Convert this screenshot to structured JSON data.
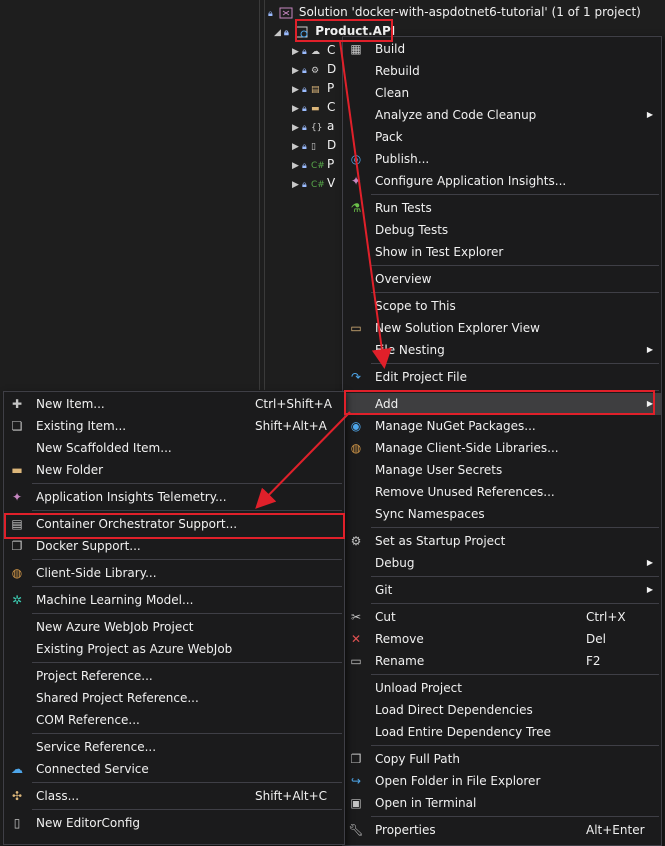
{
  "explorer": {
    "solution": "Solution 'docker-with-aspdotnet6-tutorial'   (1 of 1 project)",
    "project": "Product.API",
    "children": [
      "C",
      "D",
      "P",
      "C",
      "a",
      "D",
      "P",
      "V"
    ]
  },
  "context_menu": {
    "items": [
      {
        "label": "Build",
        "icon": "build-icon"
      },
      {
        "label": "Rebuild"
      },
      {
        "label": "Clean"
      },
      {
        "label": "Analyze and Code Cleanup",
        "submenu": true
      },
      {
        "label": "Pack"
      },
      {
        "label": "Publish...",
        "icon": "publish-globe-icon"
      },
      {
        "label": "Configure Application Insights...",
        "icon": "app-insights-icon"
      },
      {
        "sep": true
      },
      {
        "label": "Run Tests",
        "icon": "run-tests-icon"
      },
      {
        "label": "Debug Tests"
      },
      {
        "label": "Show in Test Explorer"
      },
      {
        "sep": true
      },
      {
        "label": "Overview"
      },
      {
        "sep": true
      },
      {
        "label": "Scope to This"
      },
      {
        "label": "New Solution Explorer View",
        "icon": "new-view-icon"
      },
      {
        "label": "File Nesting",
        "submenu": true
      },
      {
        "sep": true
      },
      {
        "label": "Edit Project File",
        "icon": "edit-arrow-icon"
      },
      {
        "sep": true
      },
      {
        "label": "Add",
        "submenu": true,
        "highlight": true
      },
      {
        "label": "Manage NuGet Packages...",
        "icon": "nuget-icon"
      },
      {
        "label": "Manage Client-Side Libraries...",
        "icon": "client-lib-icon"
      },
      {
        "label": "Manage User Secrets"
      },
      {
        "label": "Remove Unused References..."
      },
      {
        "label": "Sync Namespaces"
      },
      {
        "sep": true
      },
      {
        "label": "Set as Startup Project",
        "icon": "gear-icon"
      },
      {
        "label": "Debug",
        "submenu": true
      },
      {
        "sep": true
      },
      {
        "label": "Git",
        "submenu": true
      },
      {
        "sep": true
      },
      {
        "label": "Cut",
        "icon": "scissors-icon",
        "shortcut": "Ctrl+X"
      },
      {
        "label": "Remove",
        "icon": "remove-x-icon",
        "shortcut": "Del"
      },
      {
        "label": "Rename",
        "icon": "rename-icon",
        "shortcut": "F2"
      },
      {
        "sep": true
      },
      {
        "label": "Unload Project"
      },
      {
        "label": "Load Direct Dependencies"
      },
      {
        "label": "Load Entire Dependency Tree"
      },
      {
        "sep": true
      },
      {
        "label": "Copy Full Path",
        "icon": "copy-icon"
      },
      {
        "label": "Open Folder in File Explorer",
        "icon": "open-folder-icon"
      },
      {
        "label": "Open in Terminal",
        "icon": "terminal-icon"
      },
      {
        "sep": true
      },
      {
        "label": "Properties",
        "icon": "wrench-icon",
        "shortcut": "Alt+Enter"
      }
    ]
  },
  "add_menu": {
    "items": [
      {
        "label": "New Item...",
        "icon": "new-item-icon",
        "shortcut": "Ctrl+Shift+A"
      },
      {
        "label": "Existing Item...",
        "icon": "existing-item-icon",
        "shortcut": "Shift+Alt+A"
      },
      {
        "label": "New Scaffolded Item..."
      },
      {
        "label": "New Folder",
        "icon": "new-folder-icon"
      },
      {
        "sep": true
      },
      {
        "label": "Application Insights Telemetry...",
        "icon": "app-insights-icon"
      },
      {
        "sep": true
      },
      {
        "label": "Container Orchestrator Support...",
        "icon": "container-icon",
        "boxed": true
      },
      {
        "label": "Docker Support...",
        "icon": "docker-icon"
      },
      {
        "sep": true
      },
      {
        "label": "Client-Side Library...",
        "icon": "client-lib-icon"
      },
      {
        "sep": true
      },
      {
        "label": "Machine Learning Model...",
        "icon": "ml-model-icon"
      },
      {
        "sep": true
      },
      {
        "label": "New Azure WebJob Project"
      },
      {
        "label": "Existing Project as Azure WebJob"
      },
      {
        "sep": true
      },
      {
        "label": "Project Reference..."
      },
      {
        "label": "Shared Project Reference..."
      },
      {
        "label": "COM Reference..."
      },
      {
        "sep": true
      },
      {
        "label": "Service Reference..."
      },
      {
        "label": "Connected Service",
        "icon": "connected-service-icon"
      },
      {
        "sep": true
      },
      {
        "label": "Class...",
        "icon": "class-icon",
        "shortcut": "Shift+Alt+C"
      },
      {
        "sep": true
      },
      {
        "label": "New EditorConfig",
        "icon": "editorconfig-icon"
      }
    ]
  },
  "colors": {
    "annotation": "#e0202a",
    "menu_bg": "#1b1b1c",
    "highlight": "#3e3e40"
  }
}
